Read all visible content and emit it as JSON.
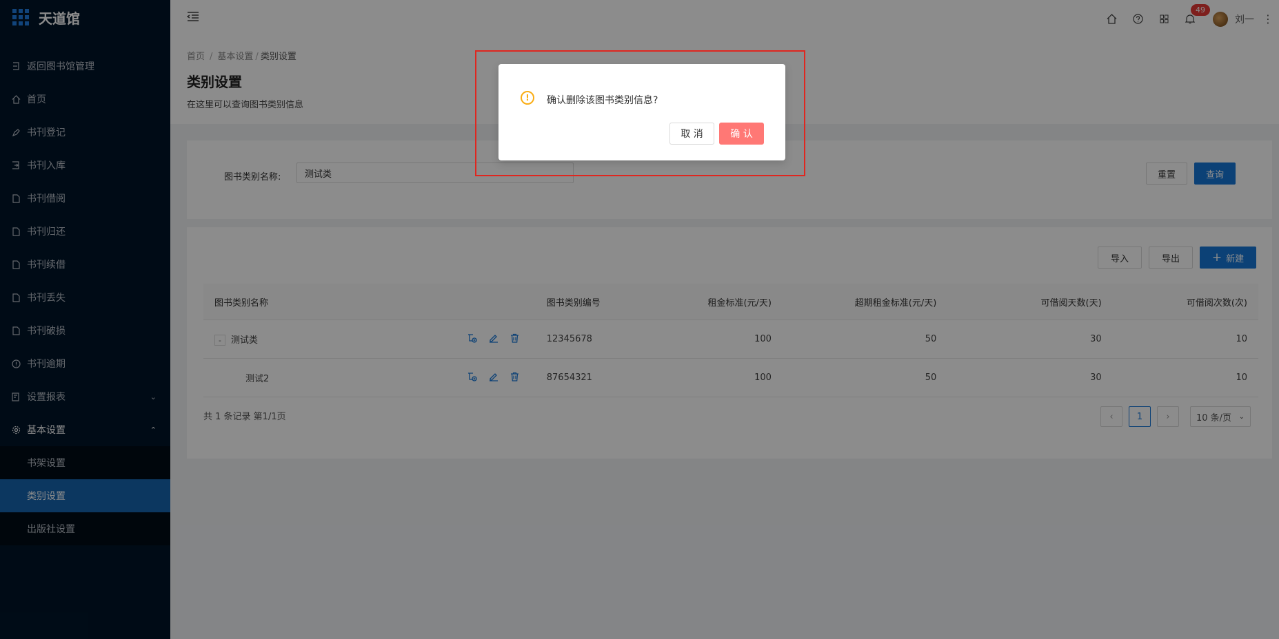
{
  "app": {
    "title": "天道馆"
  },
  "sidebar": {
    "items": [
      {
        "label": "返回图书馆管理",
        "icon": "return-icon"
      },
      {
        "label": "首页",
        "icon": "home-icon"
      },
      {
        "label": "书刊登记",
        "icon": "pen-icon"
      },
      {
        "label": "书刊入库",
        "icon": "login-icon"
      },
      {
        "label": "书刊借阅",
        "icon": "file-icon"
      },
      {
        "label": "书刊归还",
        "icon": "file-icon"
      },
      {
        "label": "书刊续借",
        "icon": "file-icon"
      },
      {
        "label": "书刊丢失",
        "icon": "file-icon"
      },
      {
        "label": "书刊破损",
        "icon": "file-icon"
      },
      {
        "label": "书刊逾期",
        "icon": "info-icon"
      },
      {
        "label": "设置报表",
        "icon": "report-icon"
      },
      {
        "label": "基本设置",
        "icon": "gear-icon"
      }
    ],
    "submenu": [
      "书架设置",
      "类别设置",
      "出版社设置"
    ],
    "active_submenu": "类别设置"
  },
  "header": {
    "notification_count": "49",
    "username": "刘一"
  },
  "breadcrumb": [
    "首页",
    "基本设置",
    "类别设置"
  ],
  "page": {
    "title": "类别设置",
    "description": "在这里可以查询图书类别信息"
  },
  "search": {
    "label": "图书类别名称:",
    "value": "测试类",
    "reset_label": "重置",
    "query_label": "查询"
  },
  "toolbar": {
    "import_label": "导入",
    "export_label": "导出",
    "new_label": "新建"
  },
  "table": {
    "headers": [
      "图书类别名称",
      "图书类别编号",
      "租金标准(元/天)",
      "超期租金标准(元/天)",
      "可借阅天数(天)",
      "可借阅次数(次)"
    ],
    "rows": [
      {
        "name": "测试类",
        "code": "12345678",
        "rent": "100",
        "overdue_rent": "50",
        "days": "30",
        "times": "10",
        "expand": "-"
      },
      {
        "name": "测试2",
        "code": "87654321",
        "rent": "100",
        "overdue_rent": "50",
        "days": "30",
        "times": "10"
      }
    ]
  },
  "pagination": {
    "summary": "共 1 条记录 第1/1页",
    "current": "1",
    "page_size": "10 条/页"
  },
  "modal": {
    "message": "确认删除该图书类别信息?",
    "cancel_label": "取 消",
    "ok_label": "确 认"
  },
  "colors": {
    "primary": "#1677d8",
    "danger": "#ff7875",
    "warning": "#faad14",
    "sidebar": "#001529",
    "highlight": "#e0261f"
  }
}
